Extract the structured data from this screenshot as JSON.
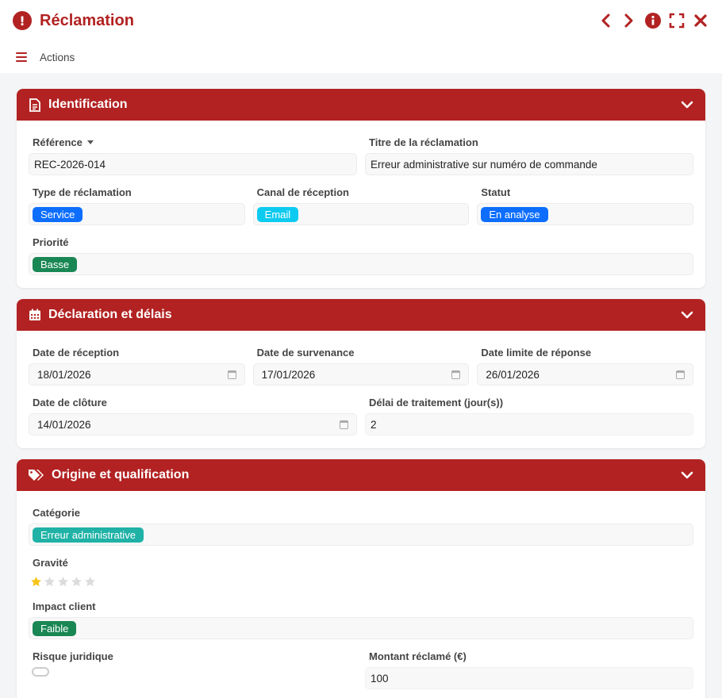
{
  "window": {
    "title": "Réclamation"
  },
  "toolbar": {
    "actions_label": "Actions"
  },
  "colors": {
    "accent": "#b22222",
    "blue": "#0d6efd",
    "cyan": "#0dcaf0",
    "green": "#198754",
    "teal": "#20c997",
    "star": "#f5c518"
  },
  "sections": {
    "identification": {
      "title": "Identification",
      "reference": {
        "label": "Référence",
        "value": "REC-2026-014"
      },
      "titre": {
        "label": "Titre de la réclamation",
        "value": "Erreur administrative sur numéro de commande"
      },
      "type": {
        "label": "Type de réclamation",
        "value": "Service"
      },
      "canal": {
        "label": "Canal de réception",
        "value": "Email"
      },
      "statut": {
        "label": "Statut",
        "value": "En analyse"
      },
      "priorite": {
        "label": "Priorité",
        "value": "Basse"
      }
    },
    "declaration": {
      "title": "Déclaration et délais",
      "date_reception": {
        "label": "Date de réception",
        "value": "18/01/2026"
      },
      "date_survenance": {
        "label": "Date de survenance",
        "value": "17/01/2026"
      },
      "date_limite": {
        "label": "Date limite de réponse",
        "value": "26/01/2026"
      },
      "date_cloture": {
        "label": "Date de clôture",
        "value": "14/01/2026"
      },
      "delai": {
        "label": "Délai de traitement (jour(s))",
        "value": "2"
      }
    },
    "origine": {
      "title": "Origine et qualification",
      "categorie": {
        "label": "Catégorie",
        "value": "Erreur administrative"
      },
      "gravite": {
        "label": "Gravité",
        "rating": 1,
        "max": 5
      },
      "impact": {
        "label": "Impact client",
        "value": "Faible"
      },
      "risque": {
        "label": "Risque juridique"
      },
      "montant": {
        "label": "Montant réclamé (€)",
        "value": "100"
      }
    }
  }
}
